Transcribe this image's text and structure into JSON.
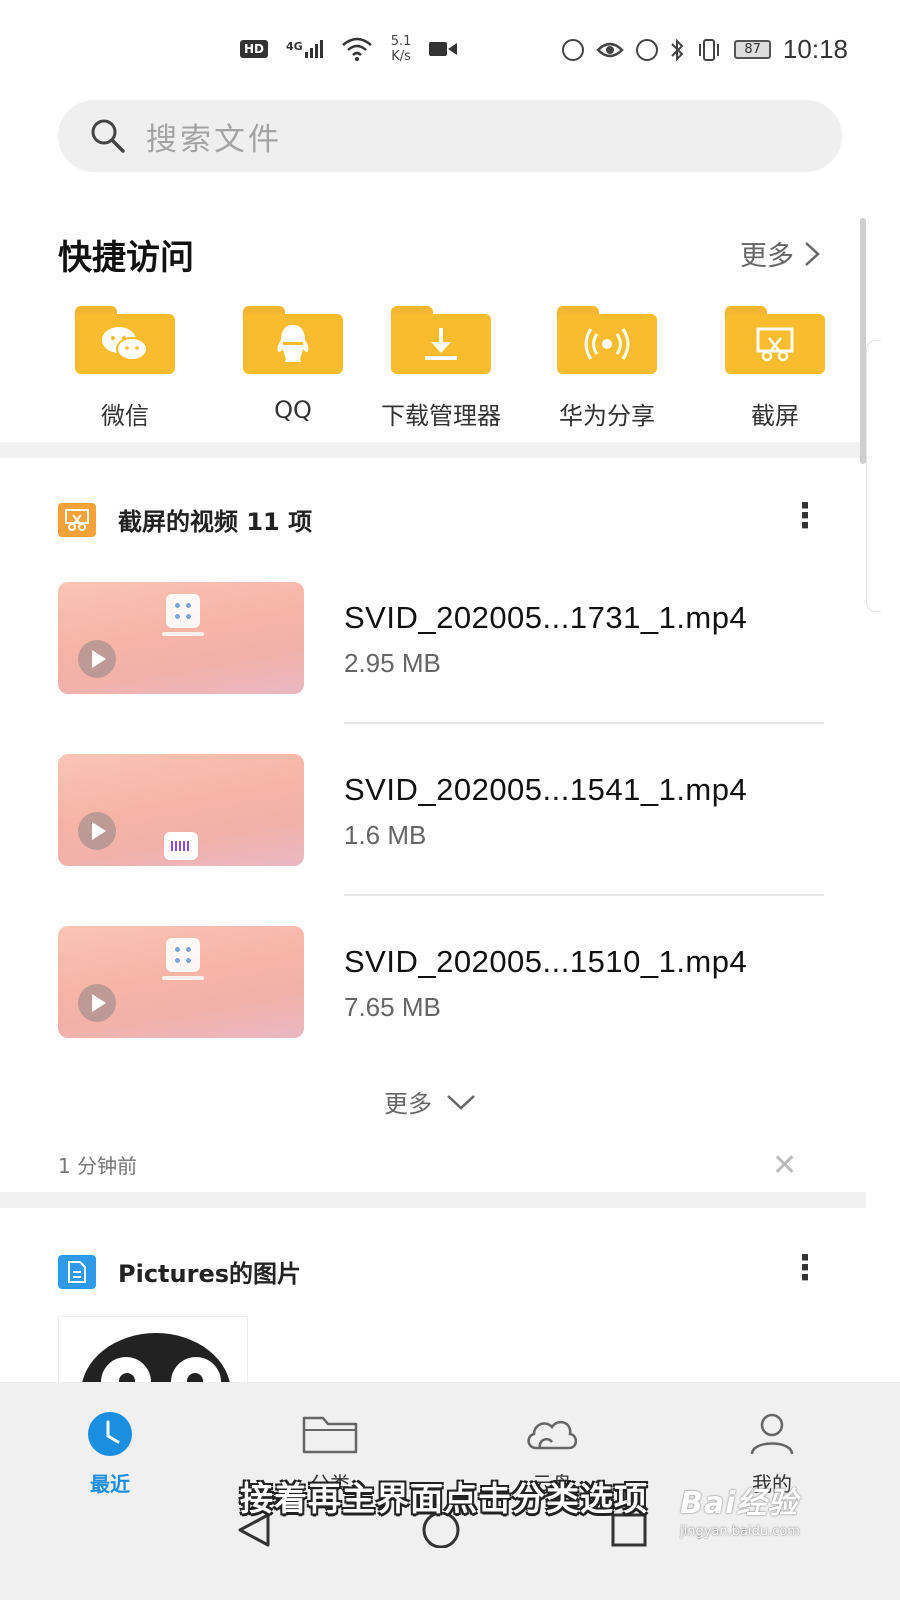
{
  "status_bar": {
    "hd": "HD",
    "network": "4G",
    "speed_value": "5.1",
    "speed_unit": "K/s",
    "battery": "87",
    "time": "10:18"
  },
  "search": {
    "placeholder": "搜索文件"
  },
  "quick_access": {
    "title": "快捷访问",
    "more_label": "更多",
    "items": [
      {
        "label": "微信",
        "icon": "wechat-icon"
      },
      {
        "label": "QQ",
        "icon": "qq-icon"
      },
      {
        "label": "下载管理器",
        "icon": "download-icon"
      },
      {
        "label": "华为分享",
        "icon": "share-icon"
      },
      {
        "label": "截屏",
        "icon": "screenshot-icon"
      }
    ],
    "folder_color": "#f9bc2f"
  },
  "recent_videos": {
    "title": "截屏的视频 11 项",
    "files": [
      {
        "name": "SVID_202005...1731_1.mp4",
        "size": "2.95 MB"
      },
      {
        "name": "SVID_202005...1541_1.mp4",
        "size": "1.6 MB"
      },
      {
        "name": "SVID_202005...1510_1.mp4",
        "size": "7.65 MB"
      }
    ],
    "more_label": "更多",
    "time_ago": "1 分钟前",
    "icon_color": "#f5a23a"
  },
  "pictures": {
    "title": "Pictures的图片",
    "icon_color": "#2f9be8"
  },
  "bottom_nav": {
    "items": [
      {
        "label": "最近",
        "icon": "clock-icon",
        "active": true
      },
      {
        "label": "分类",
        "icon": "folder-icon",
        "active": false
      },
      {
        "label": "云盘",
        "icon": "cloud-icon",
        "active": false
      },
      {
        "label": "我的",
        "icon": "person-icon",
        "active": false
      }
    ],
    "active_color": "#1a8fe0"
  },
  "overlay": {
    "subtitle": "接着再主界面点击分类选项",
    "watermark": "Bai经验",
    "watermark_url": "jingyan.baidu.com"
  }
}
